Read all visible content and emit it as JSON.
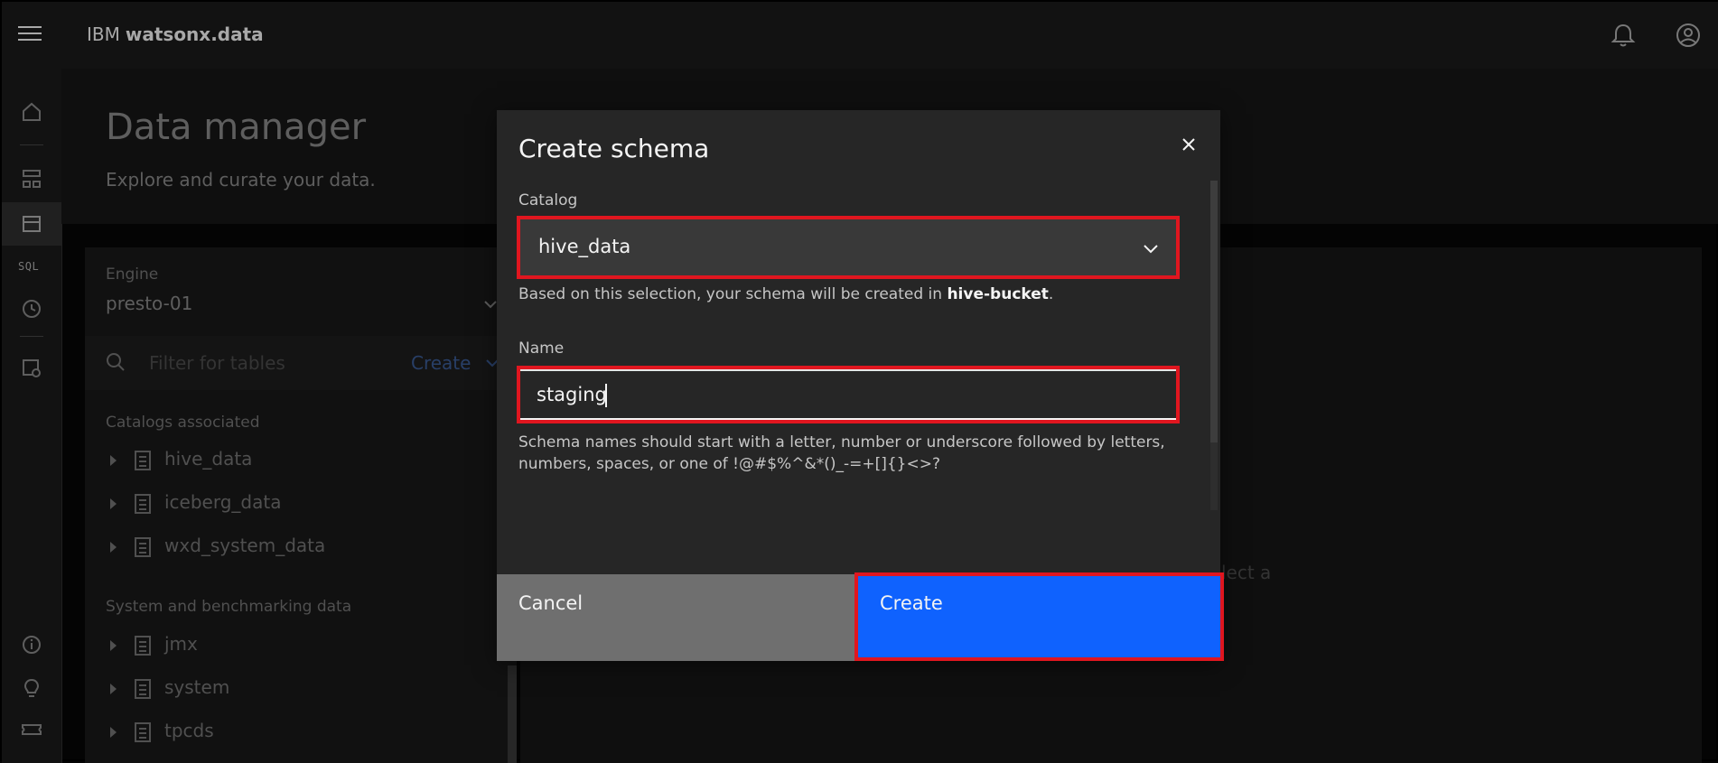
{
  "header": {
    "brand_prefix": "IBM",
    "brand_product": "watsonx.data",
    "icons": [
      "menu-icon",
      "notification-icon",
      "user-avatar-icon"
    ]
  },
  "rail": {
    "sql_label": "SQL",
    "icons": [
      "home-icon",
      "infrastructure-icon",
      "data-manager-icon",
      "sql-icon",
      "history-icon",
      "access-control-icon",
      "info-icon",
      "idea-icon",
      "ticket-icon"
    ]
  },
  "page": {
    "title": "Data manager",
    "subtitle": "Explore and curate your data.",
    "engine_label": "Engine",
    "engine_value": "presto-01",
    "search_placeholder": "Filter for tables",
    "create_label": "Create",
    "catalogs_title": "Catalogs associated",
    "catalogs": [
      "hive_data",
      "iceberg_data",
      "wxd_system_data"
    ],
    "system_title": "System and benchmarking data",
    "system_items": [
      "jmx",
      "system",
      "tpcds"
    ],
    "behind_text": "lect a"
  },
  "modal": {
    "title": "Create schema",
    "catalog_label": "Catalog",
    "catalog_value": "hive_data",
    "catalog_helper_prefix": "Based on this selection, your schema will be created in",
    "catalog_helper_bucket": "hive-bucket",
    "catalog_helper_suffix": ".",
    "name_label": "Name",
    "name_value": "staging",
    "name_helper_line1": "Schema names should start with a letter, number or underscore followed by letters,",
    "name_helper_line2": "numbers, spaces, or one of !@#$%^&*()_-=+[]{}<>?",
    "cancel_label": "Cancel",
    "create_label": "Create"
  },
  "colors": {
    "primary_button": "#0f62fe",
    "secondary_button": "#6f6f6f",
    "highlight": "#e0161f",
    "modal_bg": "#262626"
  }
}
